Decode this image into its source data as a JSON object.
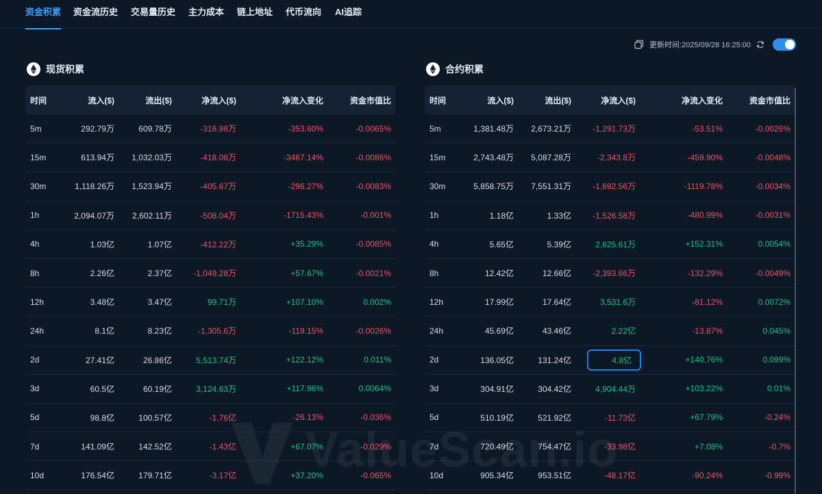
{
  "tabs": [
    {
      "label": "资金积累",
      "active": true
    },
    {
      "label": "资金流历史",
      "active": false
    },
    {
      "label": "交易量历史",
      "active": false
    },
    {
      "label": "主力成本",
      "active": false
    },
    {
      "label": "链上地址",
      "active": false
    },
    {
      "label": "代币流向",
      "active": false
    },
    {
      "label": "AI追踪",
      "active": false
    }
  ],
  "update_time": "更新时间:2025/09/28 16:25:00",
  "watermark": "ValueScan.io",
  "colors": {
    "positive": "#27c28a",
    "negative": "#f0555f",
    "accent": "#3fa0f5"
  },
  "spot": {
    "title": "现货积累",
    "headers": [
      "时间",
      "流入($)",
      "流出($)",
      "净流入($)",
      "净流入变化",
      "资金市值比"
    ],
    "rows": [
      [
        "5m",
        "292.79万",
        "609.78万",
        "-316.98万",
        "-353.60%",
        "-0.0065%"
      ],
      [
        "15m",
        "613.94万",
        "1,032.03万",
        "-418.08万",
        "-3467.14%",
        "-0.0086%"
      ],
      [
        "30m",
        "1,118.26万",
        "1,523.94万",
        "-405.67万",
        "-296.27%",
        "-0.0083%"
      ],
      [
        "1h",
        "2,094.07万",
        "2,602.11万",
        "-508.04万",
        "-1715.43%",
        "-0.001%"
      ],
      [
        "4h",
        "1.03亿",
        "1.07亿",
        "-412.22万",
        "+35.29%",
        "-0.0085%"
      ],
      [
        "8h",
        "2.26亿",
        "2.37亿",
        "-1,049.28万",
        "+57.67%",
        "-0.0021%"
      ],
      [
        "12h",
        "3.48亿",
        "3.47亿",
        "99.71万",
        "+107.10%",
        "0.002%"
      ],
      [
        "24h",
        "8.1亿",
        "8.23亿",
        "-1,305.6万",
        "-119.15%",
        "-0.0026%"
      ],
      [
        "2d",
        "27.41亿",
        "26.86亿",
        "5,513.74万",
        "+122.12%",
        "0.011%"
      ],
      [
        "3d",
        "60.5亿",
        "60.19亿",
        "3,124.63万",
        "+117.96%",
        "0.0064%"
      ],
      [
        "5d",
        "98.8亿",
        "100.57亿",
        "-1.76亿",
        "-26.13%",
        "-0.036%"
      ],
      [
        "7d",
        "141.09亿",
        "142.52亿",
        "-1.43亿",
        "+67.07%",
        "-0.029%"
      ],
      [
        "10d",
        "176.54亿",
        "179.71亿",
        "-3.17亿",
        "+37.20%",
        "-0.065%"
      ]
    ]
  },
  "contract": {
    "title": "合约积累",
    "headers": [
      "时间",
      "流入($)",
      "流出($)",
      "净流入($)",
      "净流入变化",
      "资金市值比"
    ],
    "highlight_row": 8,
    "rows": [
      [
        "5m",
        "1,381.48万",
        "2,673.21万",
        "-1,291.73万",
        "-53.51%",
        "-0.0026%"
      ],
      [
        "15m",
        "2,743.48万",
        "5,087.28万",
        "-2,343.8万",
        "-459.90%",
        "-0.0048%"
      ],
      [
        "30m",
        "5,858.75万",
        "7,551.31万",
        "-1,692.56万",
        "-1119.78%",
        "-0.0034%"
      ],
      [
        "1h",
        "1.18亿",
        "1.33亿",
        "-1,526.58万",
        "-480.99%",
        "-0.0031%"
      ],
      [
        "4h",
        "5.65亿",
        "5.39亿",
        "2,625.61万",
        "+152.31%",
        "0.0054%"
      ],
      [
        "8h",
        "12.42亿",
        "12.66亿",
        "-2,393.66万",
        "-132.29%",
        "-0.0049%"
      ],
      [
        "12h",
        "17.99亿",
        "17.64亿",
        "3,531.6万",
        "-81.12%",
        "0.0072%"
      ],
      [
        "24h",
        "45.69亿",
        "43.46亿",
        "2.22亿",
        "-13.87%",
        "0.045%"
      ],
      [
        "2d",
        "136.05亿",
        "131.24亿",
        "4.8亿",
        "+140.76%",
        "0.099%"
      ],
      [
        "3d",
        "304.91亿",
        "304.42亿",
        "4,904.44万",
        "+103.22%",
        "0.01%"
      ],
      [
        "5d",
        "510.19亿",
        "521.92亿",
        "-11.73亿",
        "+67.79%",
        "-0.24%"
      ],
      [
        "7d",
        "720.49亿",
        "754.47亿",
        "-33.98亿",
        "+7.08%",
        "-0.7%"
      ],
      [
        "10d",
        "905.34亿",
        "953.51亿",
        "-48.17亿",
        "-90.24%",
        "-0.99%"
      ]
    ]
  }
}
